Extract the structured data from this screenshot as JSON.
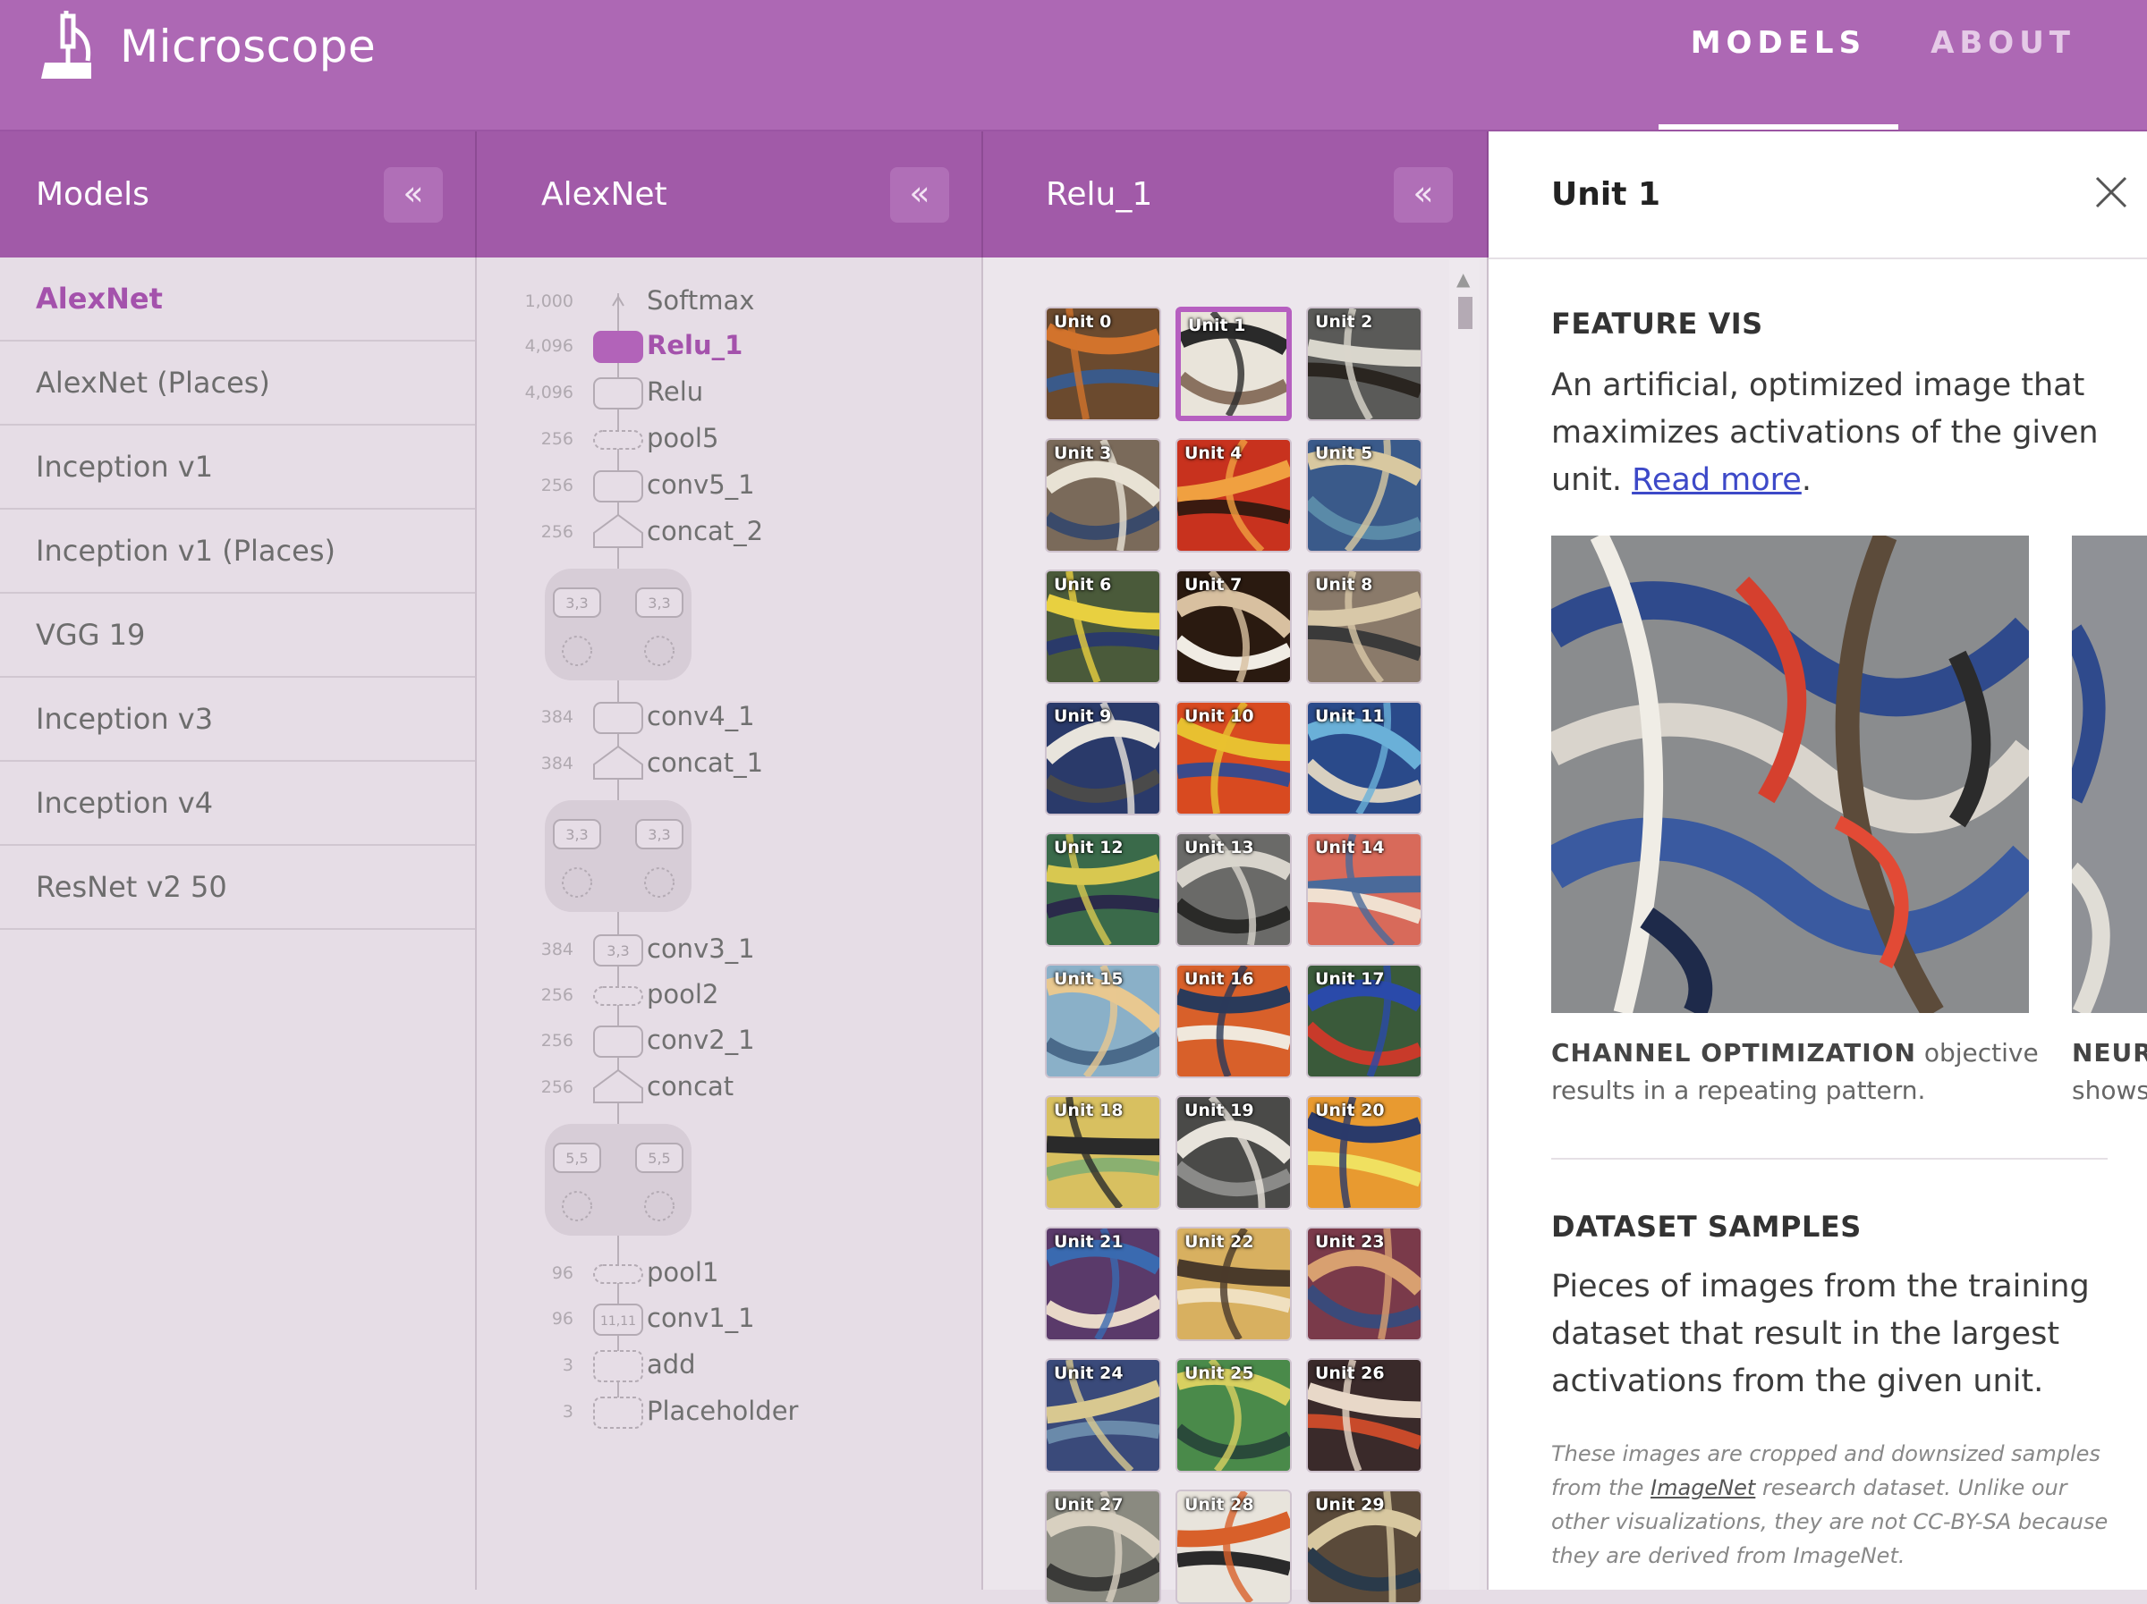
{
  "app": {
    "title": "Microscope"
  },
  "nav": {
    "models": "MODELS",
    "about": "ABOUT"
  },
  "columns": {
    "models_title": "Models",
    "model_title": "AlexNet",
    "layer_title": "Relu_1",
    "collapse_glyph": "«"
  },
  "models": [
    "AlexNet",
    "AlexNet (Places)",
    "Inception v1",
    "Inception v1 (Places)",
    "VGG 19",
    "Inception v3",
    "Inception v4",
    "ResNet v2 50"
  ],
  "selected_model": "AlexNet",
  "layers": [
    {
      "count": "1,000",
      "name": "Softmax"
    },
    {
      "count": "4,096",
      "name": "Relu_1",
      "selected": true
    },
    {
      "count": "4,096",
      "name": "Relu"
    },
    {
      "count": "256",
      "name": "pool5"
    },
    {
      "count": "256",
      "name": "conv5_1"
    },
    {
      "count": "256",
      "name": "concat_2"
    },
    {
      "count": "384",
      "name": "conv4_1"
    },
    {
      "count": "384",
      "name": "concat_1"
    },
    {
      "count": "384",
      "name": "conv3_1",
      "kernel": "3,3"
    },
    {
      "count": "256",
      "name": "pool2"
    },
    {
      "count": "256",
      "name": "conv2_1"
    },
    {
      "count": "256",
      "name": "concat"
    },
    {
      "count": "96",
      "name": "pool1"
    },
    {
      "count": "96",
      "name": "conv1_1",
      "kernel": "11,11"
    },
    {
      "count": "3",
      "name": "add"
    },
    {
      "count": "3",
      "name": "Placeholder"
    }
  ],
  "kernel_labels": {
    "group_a": "3,3",
    "group_b": "3,3",
    "group_c": "5,5"
  },
  "units": [
    "Unit 0",
    "Unit 1",
    "Unit 2",
    "Unit 3",
    "Unit 4",
    "Unit 5",
    "Unit 6",
    "Unit 7",
    "Unit 8",
    "Unit 9",
    "Unit 10",
    "Unit 11",
    "Unit 12",
    "Unit 13",
    "Unit 14",
    "Unit 15",
    "Unit 16",
    "Unit 17",
    "Unit 18",
    "Unit 19",
    "Unit 20",
    "Unit 21",
    "Unit 22",
    "Unit 23",
    "Unit 24",
    "Unit 25",
    "Unit 26",
    "Unit 27",
    "Unit 28",
    "Unit 29"
  ],
  "selected_unit": "Unit 1",
  "detail": {
    "title": "Unit 1",
    "feature_vis": {
      "heading": "FEATURE VIS",
      "text": "An artificial, optimized image that maximizes activations of the given unit.",
      "link": "Read more",
      "link_suffix": "."
    },
    "caption_channel": {
      "bold": "CHANNEL OPTIMIZATION",
      "text": " objective results in a repeating pattern."
    },
    "caption_neuron": {
      "bold": "NEURO",
      "text": "shows"
    },
    "dataset": {
      "heading": "DATASET SAMPLES",
      "text": "Pieces of images from the training dataset that result in the largest activations from the given unit.",
      "note_pre": "These images are cropped and downsized samples from the ",
      "note_link": "ImageNet",
      "note_post": " research dataset. Unlike our other visualizations, they are not CC-BY-SA because they are derived from ImageNet."
    }
  },
  "colors": {
    "header": "#ad68b4",
    "column_header": "#a15aa8",
    "accent": "#a452ac",
    "link": "#3d49c8"
  }
}
